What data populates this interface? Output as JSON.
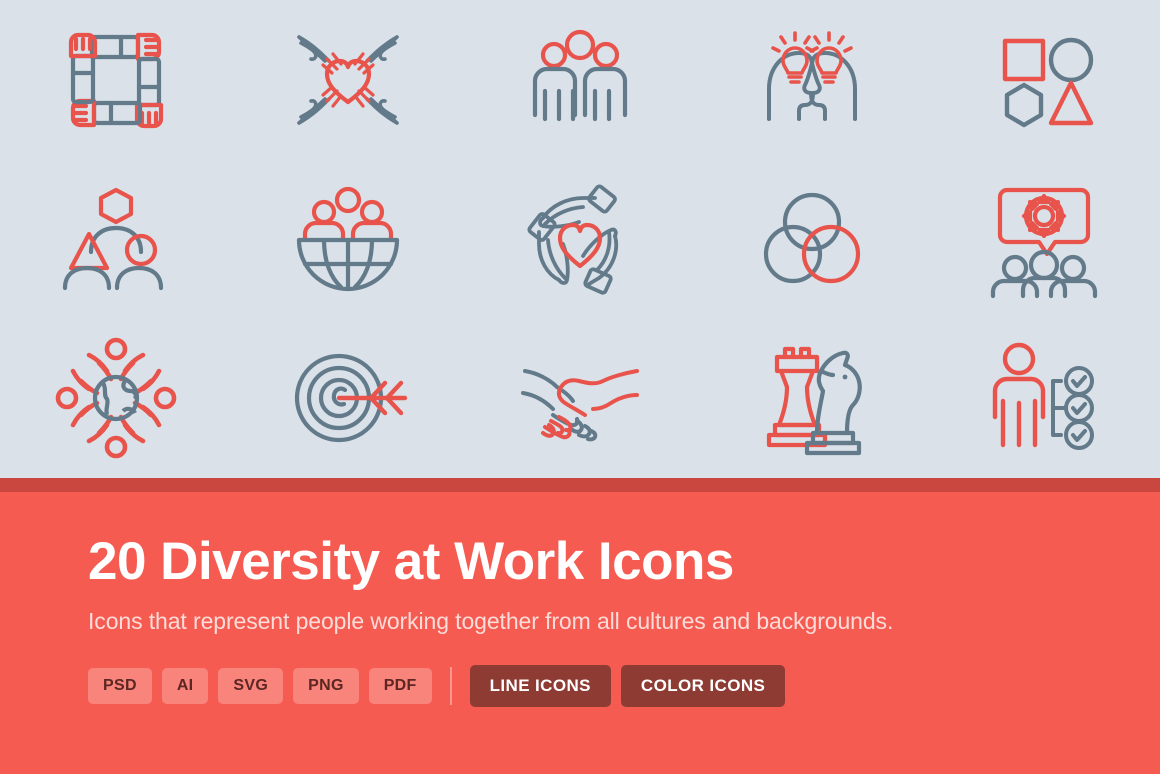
{
  "colors": {
    "background_grey": "#dae1e8",
    "banner_red": "#f65b51",
    "divider_red": "#c9473f",
    "icon_red": "#e8544b",
    "icon_slate": "#627a8a",
    "badge_format_bg": "#f9847c",
    "badge_type_bg": "#8d3b33",
    "title_white": "#ffffff",
    "subtitle_pink": "#fcdcd8"
  },
  "banner": {
    "title": "20 Diversity at Work Icons",
    "subtitle": "Icons that represent people working together from all cultures and backgrounds.",
    "format_badges": [
      {
        "label": "PSD"
      },
      {
        "label": "AI"
      },
      {
        "label": "SVG"
      },
      {
        "label": "PNG"
      },
      {
        "label": "PDF"
      }
    ],
    "type_badges": [
      {
        "label": "LINE ICONS"
      },
      {
        "label": "COLOR ICONS"
      }
    ]
  },
  "icon_grid": {
    "rows": 3,
    "columns": 5,
    "icons": [
      {
        "name": "four-arms-square-icon",
        "label": "Four interlocking arms forming a square"
      },
      {
        "name": "hands-around-heart-icon",
        "label": "Four hands reaching toward a heart"
      },
      {
        "name": "group-of-three-people-icon",
        "label": "Group of three people"
      },
      {
        "name": "two-heads-lightbulbs-icon",
        "label": "Two facing heads with lightbulbs"
      },
      {
        "name": "four-shapes-icon",
        "label": "Square, circle, hexagon and triangle shapes"
      },
      {
        "name": "people-different-head-shapes-icon",
        "label": "Three people with hexagon, triangle and circle heads"
      },
      {
        "name": "people-on-globe-icon",
        "label": "Three people above a globe hemisphere"
      },
      {
        "name": "three-hands-protecting-heart-icon",
        "label": "Three hands protecting a heart"
      },
      {
        "name": "overlapping-circles-venn-icon",
        "label": "Three overlapping circles"
      },
      {
        "name": "team-gear-speech-bubble-icon",
        "label": "Speech bubble with gear above three people"
      },
      {
        "name": "people-around-globe-icon",
        "label": "Four people encircling a globe"
      },
      {
        "name": "target-arrow-icon",
        "label": "Spiral target with arrow"
      },
      {
        "name": "handshake-icon",
        "label": "Handshake between two hands"
      },
      {
        "name": "chess-rook-knight-icon",
        "label": "Chess rook and knight pieces"
      },
      {
        "name": "person-checklist-icon",
        "label": "Person with three checkmark circles"
      }
    ]
  }
}
